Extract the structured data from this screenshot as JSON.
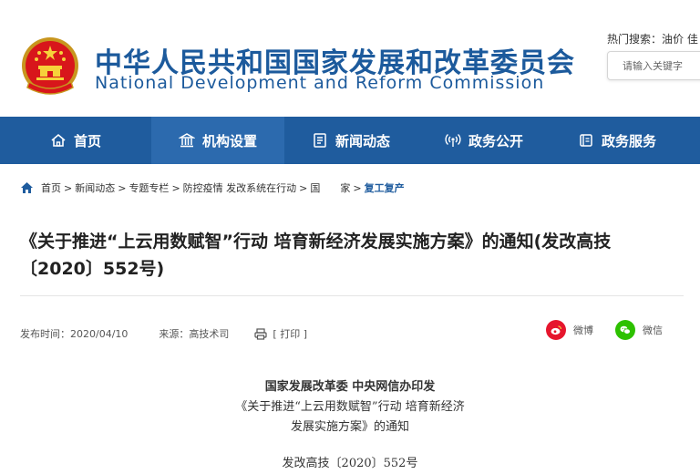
{
  "header": {
    "title_cn": "中华人民共和国国家发展和改革委员会",
    "title_en": "National Development and Reform Commission",
    "hot_search": "热门搜索：油价   佳",
    "search_placeholder": "请输入关键字"
  },
  "nav": {
    "items": [
      {
        "label": "首页",
        "icon": "home-icon"
      },
      {
        "label": "机构设置",
        "icon": "building-icon"
      },
      {
        "label": "新闻动态",
        "icon": "news-icon"
      },
      {
        "label": "政务公开",
        "icon": "broadcast-icon"
      },
      {
        "label": "政务服务",
        "icon": "service-icon"
      }
    ],
    "active_index": 1
  },
  "breadcrumb": {
    "items": [
      "首页",
      "新闻动态",
      "专题专栏",
      "防控疫情 发改系统在行动",
      "国　　家"
    ],
    "current": "复工复产",
    "separator": ">"
  },
  "article": {
    "title": "《关于推进“上云用数赋智”行动 培育新经济发展实施方案》的通知(发改高技〔2020〕552号)",
    "publish_date": "发布时间：2020/04/10",
    "source": "来源：高技术司",
    "print_label": "[ 打印 ]",
    "share_weibo": "微博",
    "share_weixin": "微信",
    "body": {
      "line1": "国家发展改革委 中央网信办印发",
      "line2": "《关于推进“上云用数赋智”行动 培育新经济",
      "line3": "发展实施方案》的通知",
      "doc_no": "发改高技〔2020〕552号"
    }
  },
  "colors": {
    "brand_blue": "#1f5c9e",
    "nav_active": "#2c6aae",
    "weibo_red": "#e6162d",
    "weixin_green": "#2dc100"
  }
}
